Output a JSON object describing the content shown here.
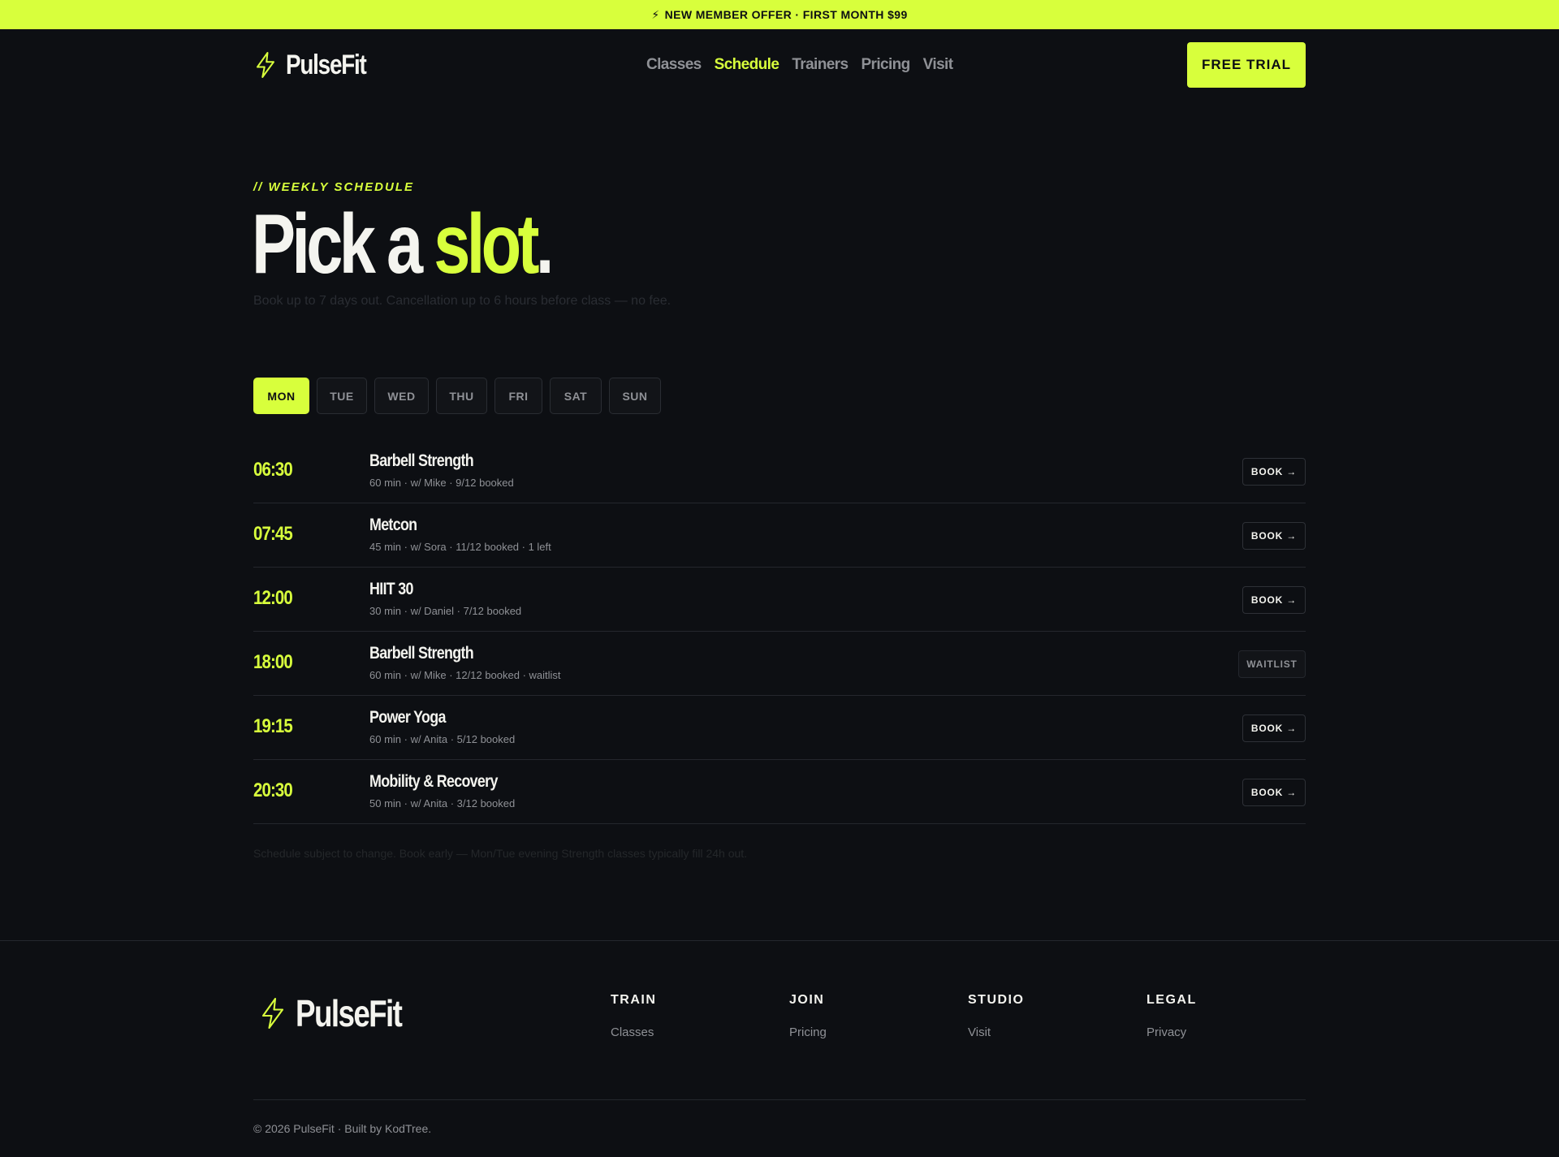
{
  "banner": {
    "icon": "bolt-icon",
    "text": "NEW MEMBER OFFER · FIRST MONTH $99"
  },
  "header": {
    "brand": "PulseFit",
    "brand_icon": "bolt-icon",
    "nav": [
      "Classes",
      "Schedule",
      "Trainers",
      "Pricing",
      "Visit"
    ],
    "active_nav": "Schedule",
    "cta_label": "FREE TRIAL"
  },
  "hero": {
    "eyebrow": "// WEEKLY SCHEDULE",
    "headline_part1": "Pick a ",
    "headline_accent": "slot",
    "headline_end": ".",
    "subhead": "Book up to 7 days out. Cancellation up to 6 hours before class — no fee."
  },
  "days": [
    "MON",
    "TUE",
    "WED",
    "THU",
    "FRI",
    "SAT",
    "SUN"
  ],
  "active_day": "MON",
  "schedule": [
    {
      "time": "06:30",
      "name": "Barbell Strength",
      "meta": "60 min · w/ Mike · 9/12 booked",
      "action": "BOOK →"
    },
    {
      "time": "07:45",
      "name": "Metcon",
      "meta": "45 min · w/ Sora · 11/12 booked · 1 left",
      "action": "BOOK →"
    },
    {
      "time": "12:00",
      "name": "HIIT 30",
      "meta": "30 min · w/ Daniel · 7/12 booked",
      "action": "BOOK →"
    },
    {
      "time": "18:00",
      "name": "Barbell Strength",
      "meta": "60 min · w/ Mike · 12/12 booked · waitlist",
      "action": "WAITLIST"
    },
    {
      "time": "19:15",
      "name": "Power Yoga",
      "meta": "60 min · w/ Anita · 5/12 booked",
      "action": "BOOK →"
    },
    {
      "time": "20:30",
      "name": "Mobility & Recovery",
      "meta": "50 min · w/ Anita · 3/12 booked",
      "action": "BOOK →"
    }
  ],
  "note": "Schedule subject to change. Book early — Mon/Tue evening Strength classes typically fill 24h out.",
  "footer": {
    "brand": "PulseFit",
    "columns": [
      {
        "heading": "TRAIN",
        "link": "Classes"
      },
      {
        "heading": "JOIN",
        "link": "Pricing"
      },
      {
        "heading": "STUDIO",
        "link": "Visit"
      },
      {
        "heading": "LEGAL",
        "link": "Privacy"
      }
    ],
    "copyright": "© 2026 PulseFit · Built by KodTree."
  },
  "colors": {
    "accent": "#d8ff3c",
    "background": "#0d0f13",
    "muted": "#8f9196"
  }
}
